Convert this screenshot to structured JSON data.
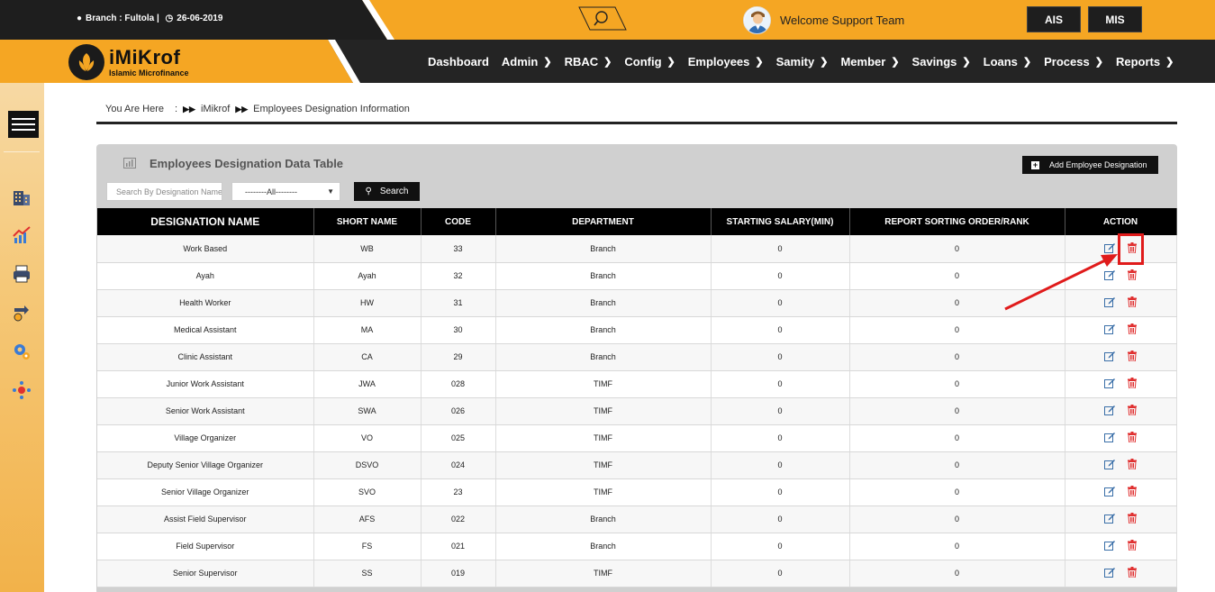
{
  "topbar": {
    "branch_text": "Branch : Fultola |",
    "date_text": "26-06-2019",
    "welcome_text": "Welcome Support Team",
    "buttons": [
      "AIS",
      "MIS"
    ]
  },
  "logo": {
    "title": "iMiKrof",
    "subtitle": "Islamic Microfinance"
  },
  "nav": {
    "items": [
      {
        "label": "Dashboard",
        "has_chevron": false
      },
      {
        "label": "Admin",
        "has_chevron": true
      },
      {
        "label": "RBAC",
        "has_chevron": true
      },
      {
        "label": "Config",
        "has_chevron": true
      },
      {
        "label": "Employees",
        "has_chevron": true
      },
      {
        "label": "Samity",
        "has_chevron": true
      },
      {
        "label": "Member",
        "has_chevron": true
      },
      {
        "label": "Savings",
        "has_chevron": true
      },
      {
        "label": "Loans",
        "has_chevron": true
      },
      {
        "label": "Process",
        "has_chevron": true
      },
      {
        "label": "Reports",
        "has_chevron": true
      }
    ]
  },
  "sidebar": {
    "icons": [
      "building-icon",
      "chart-icon",
      "printer-icon",
      "transfer-icon",
      "gears-icon",
      "network-icon"
    ]
  },
  "breadcrumb": {
    "prefix": "You Are Here",
    "colon": ":",
    "items": [
      "iMikrof",
      "Employees Designation Information"
    ]
  },
  "panel": {
    "title": "Employees Designation Data Table",
    "add_button": "Add Employee Designation",
    "search_placeholder": "Search By Designation Name",
    "select_value": "--------All--------",
    "search_button": "Search"
  },
  "table": {
    "columns": [
      "DESIGNATION NAME",
      "SHORT NAME",
      "CODE",
      "DEPARTMENT",
      "STARTING SALARY(MIN)",
      "REPORT SORTING ORDER/RANK",
      "ACTION"
    ],
    "rows": [
      [
        "Work Based",
        "WB",
        "33",
        "Branch",
        "0",
        "0"
      ],
      [
        "Ayah",
        "Ayah",
        "32",
        "Branch",
        "0",
        "0"
      ],
      [
        "Health Worker",
        "HW",
        "31",
        "Branch",
        "0",
        "0"
      ],
      [
        "Medical Assistant",
        "MA",
        "30",
        "Branch",
        "0",
        "0"
      ],
      [
        "Clinic Assistant",
        "CA",
        "29",
        "Branch",
        "0",
        "0"
      ],
      [
        "Junior Work Assistant",
        "JWA",
        "028",
        "TIMF",
        "0",
        "0"
      ],
      [
        "Senior Work Assistant",
        "SWA",
        "026",
        "TIMF",
        "0",
        "0"
      ],
      [
        "Village Organizer",
        "VO",
        "025",
        "TIMF",
        "0",
        "0"
      ],
      [
        "Deputy Senior Village Organizer",
        "DSVO",
        "024",
        "TIMF",
        "0",
        "0"
      ],
      [
        "Senior Village Organizer",
        "SVO",
        "23",
        "TIMF",
        "0",
        "0"
      ],
      [
        "Assist Field Supervisor",
        "AFS",
        "022",
        "Branch",
        "0",
        "0"
      ],
      [
        "Field Supervisor",
        "FS",
        "021",
        "Branch",
        "0",
        "0"
      ],
      [
        "Senior Supervisor",
        "SS",
        "019",
        "TIMF",
        "0",
        "0"
      ]
    ]
  },
  "colors": {
    "accent_orange": "#f5a623",
    "dark": "#1e1e1e",
    "delete_red": "#e03030",
    "annotation_red": "#e01b1b"
  }
}
